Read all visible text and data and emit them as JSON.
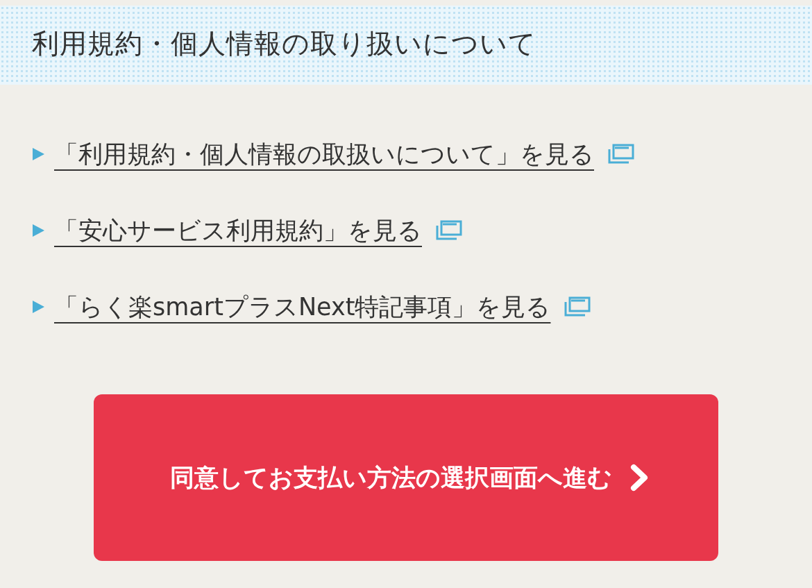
{
  "section": {
    "title": "利用規約・個人情報の取り扱いについて"
  },
  "links": [
    {
      "text": "「利用規約・個人情報の取扱いについて」を見る"
    },
    {
      "text": "「安心サービス利用規約」を見る"
    },
    {
      "text": "「らく楽smartプラスNext特記事項」を見る"
    }
  ],
  "button": {
    "label": "同意してお支払い方法の選択画面へ進む"
  }
}
